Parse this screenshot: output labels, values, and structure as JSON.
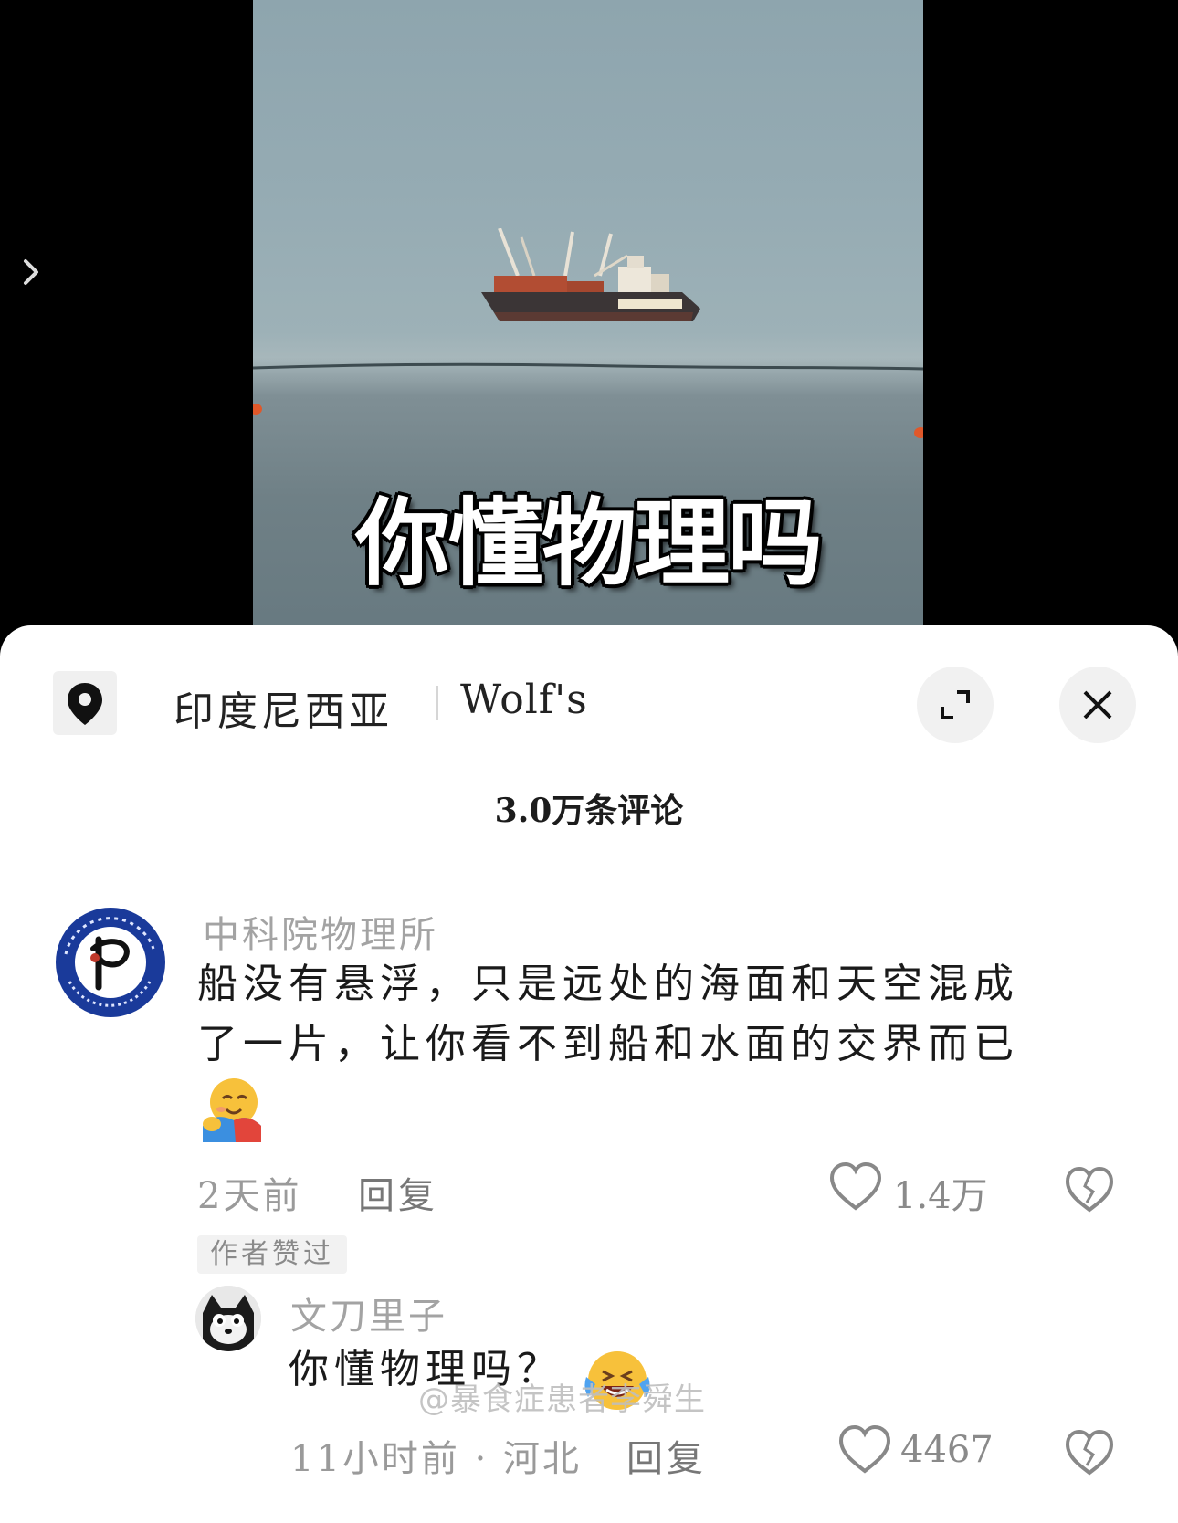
{
  "video": {
    "caption": "你懂物理吗",
    "expand_icon": "chevron-right-icon"
  },
  "header": {
    "location_icon": "location-pin-icon",
    "location_name": "印度尼西亚",
    "location_brand": "Wolf's",
    "fullscreen_icon": "fullscreen-icon",
    "close_icon": "close-icon"
  },
  "comments_count_label": "3.0万条评论",
  "comments": [
    {
      "username": "中科院物理所",
      "text_line1": "船没有悬浮，只是远处的海面和天空混成",
      "text_line2": "了一片，让你看不到船和水面的交界而已",
      "emoji": "hugging-face-emoji",
      "time": "2天前",
      "reply_label": "回复",
      "likes": "1.4万",
      "badge": "作者赞过",
      "replies": [
        {
          "username": "文刀里子",
          "text": "你懂物理吗？",
          "emoji": "loudly-crying-laughing-emoji",
          "time_location": "11小时前 · 河北",
          "reply_label": "回复",
          "likes": "4467"
        }
      ]
    }
  ],
  "watermark": "@暴食症患者李舜生",
  "colors": {
    "sheet_bg": "#ffffff",
    "muted_text": "#a3a3a3",
    "cas_blue": "#1a3a9a"
  }
}
